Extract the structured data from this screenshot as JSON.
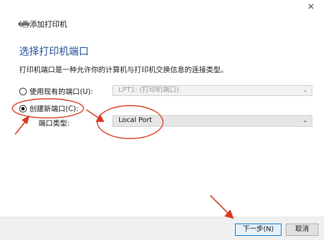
{
  "window": {
    "title": "添加打印机",
    "close_glyph": "✕"
  },
  "page": {
    "heading": "选择打印机端口",
    "description": "打印机端口是一种允许你的计算机与打印机交换信息的连接类型。"
  },
  "options": {
    "existing_port": {
      "label": "使用现有的端口(U):",
      "checked": false,
      "select_value": "LPT1: (打印机端口)"
    },
    "new_port": {
      "label": "创建新端口(C):",
      "checked": true
    },
    "port_type": {
      "label": "端口类型:",
      "select_value": "Local Port"
    }
  },
  "buttons": {
    "next": "下一步(N)",
    "cancel": "取消"
  },
  "annotations": {
    "color": "#d9371f"
  }
}
